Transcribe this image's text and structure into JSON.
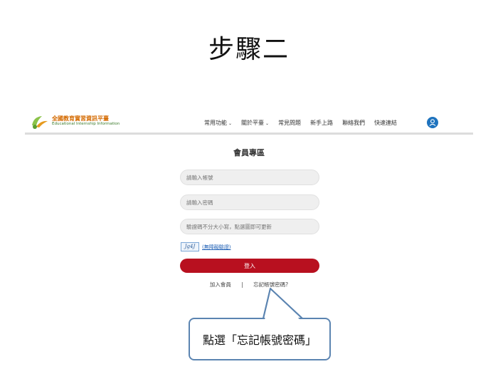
{
  "slide": {
    "title": "步驟二"
  },
  "site": {
    "name": "全國教育實習資訊平臺",
    "subtitle": "Educational Internship Information",
    "logo_icon": "leaf-logo-icon"
  },
  "nav": {
    "items": [
      {
        "label": "常用功能",
        "has_dropdown": true
      },
      {
        "label": "關於平臺",
        "has_dropdown": true
      },
      {
        "label": "常見問題",
        "has_dropdown": false
      },
      {
        "label": "新手上路",
        "has_dropdown": false
      },
      {
        "label": "聯絡我們",
        "has_dropdown": false
      },
      {
        "label": "快速連結",
        "has_dropdown": false
      }
    ],
    "user_icon": "user-icon",
    "accent": "#1e73be"
  },
  "login": {
    "title": "會員專區",
    "account_placeholder": "請輸入帳號",
    "password_placeholder": "請輸入密碼",
    "captcha_placeholder": "驗證碼不分大小寫，點選圖即可更新",
    "captcha_image_text": "Jg4J",
    "captcha_link": "(無障礙驗證)",
    "submit_label": "登入",
    "submit_color": "#b8101f"
  },
  "links": {
    "join": "加入會員",
    "separator": "|",
    "forgot": "忘記帳號密碼?"
  },
  "callout": {
    "text": "點選「忘記帳號密碼」"
  }
}
